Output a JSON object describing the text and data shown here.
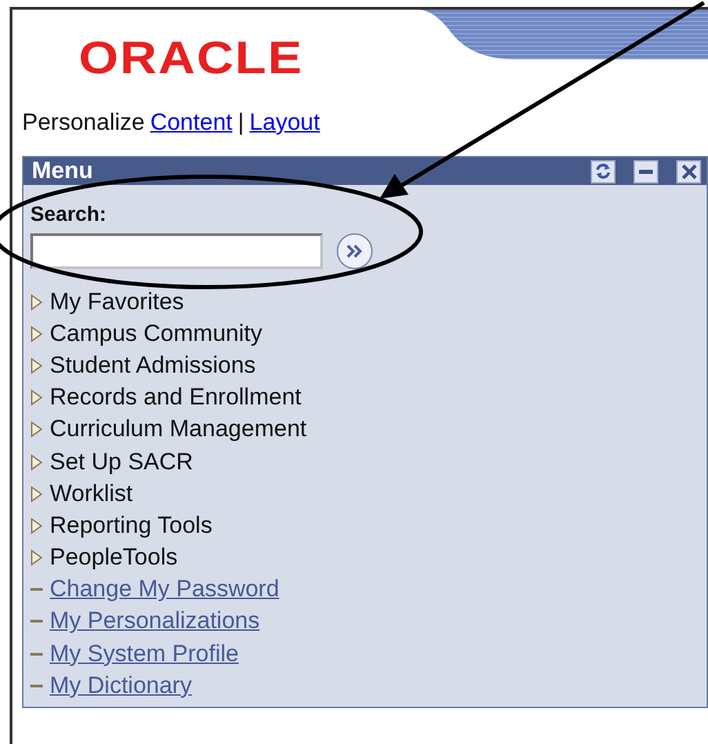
{
  "header": {
    "logo": "ORACLE"
  },
  "personalize": {
    "label": "Personalize",
    "links": [
      "Content",
      "Layout"
    ],
    "separator": "|"
  },
  "menu": {
    "title": "Menu",
    "search": {
      "label": "Search:"
    },
    "items": [
      {
        "kind": "folder",
        "label": "My Favorites"
      },
      {
        "kind": "folder",
        "label": "Campus Community"
      },
      {
        "kind": "folder",
        "label": "Student Admissions"
      },
      {
        "kind": "folder",
        "label": "Records and Enrollment"
      },
      {
        "kind": "folder",
        "label": "Curriculum Management"
      },
      {
        "kind": "folder",
        "label": "Set Up SACR"
      },
      {
        "kind": "folder",
        "label": "Worklist"
      },
      {
        "kind": "folder",
        "label": "Reporting Tools"
      },
      {
        "kind": "folder",
        "label": "PeopleTools"
      },
      {
        "kind": "link",
        "label": "Change My Password"
      },
      {
        "kind": "link",
        "label": "My Personalizations"
      },
      {
        "kind": "link",
        "label": "My System Profile"
      },
      {
        "kind": "link",
        "label": "My Dictionary"
      }
    ]
  }
}
